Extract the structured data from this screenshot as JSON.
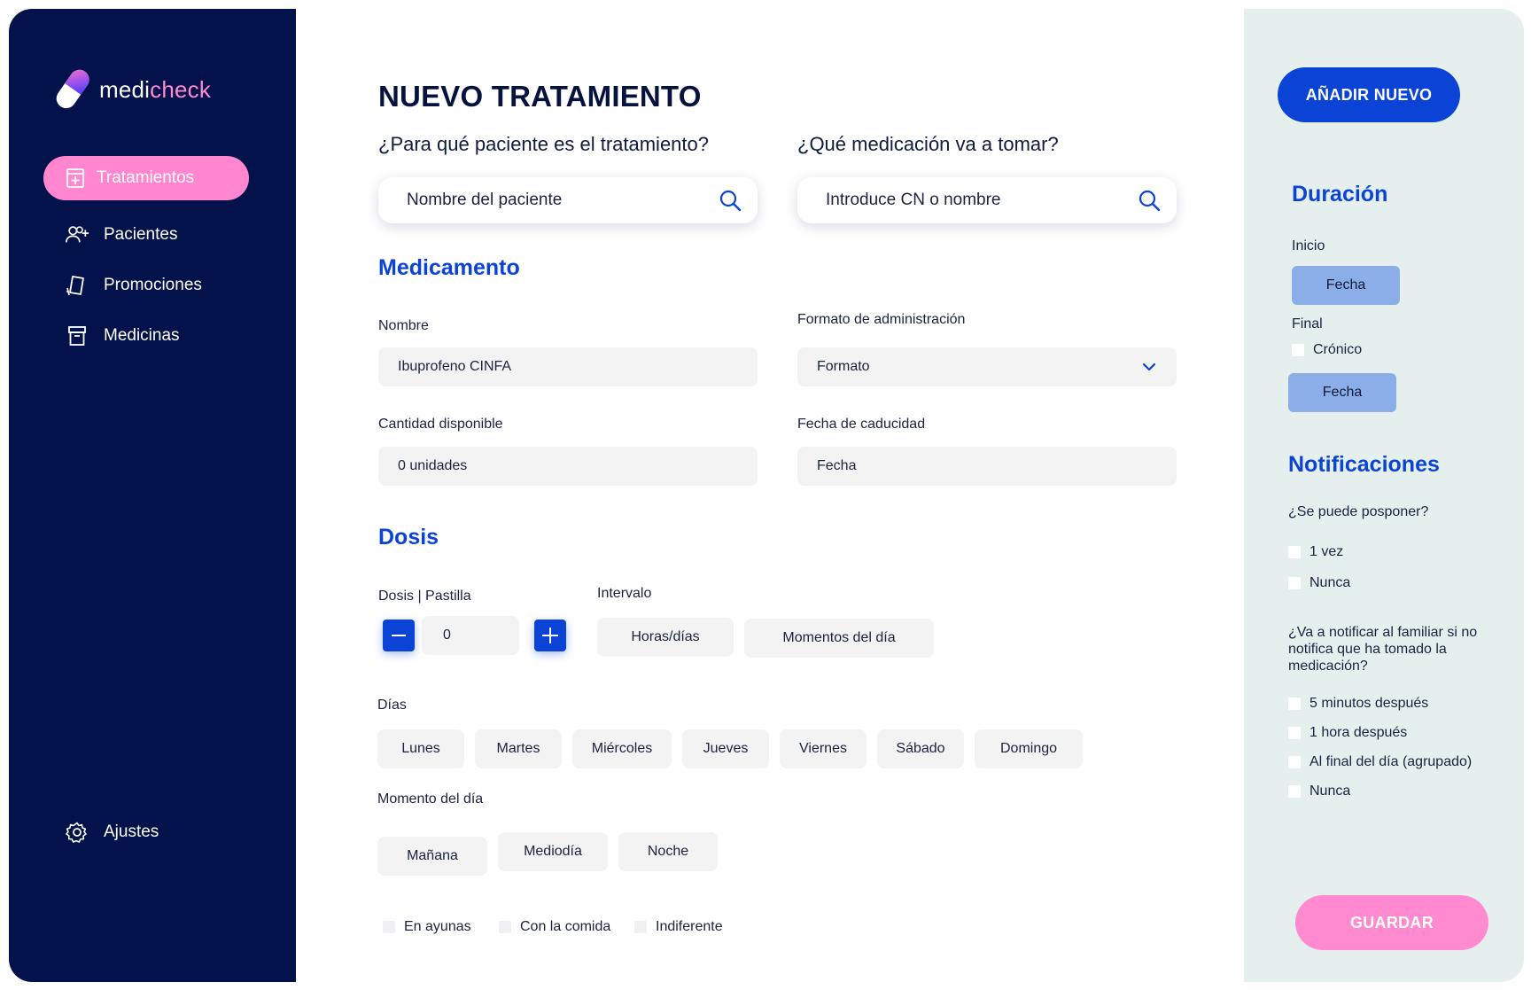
{
  "brand": {
    "name_part1": "medi",
    "name_part2": "check"
  },
  "sidebar": {
    "items": [
      {
        "label": "Tratamientos",
        "icon": "medical-box-icon",
        "active": true
      },
      {
        "label": "Pacientes",
        "icon": "add-user-icon"
      },
      {
        "label": "Promociones",
        "icon": "promotions-icon"
      },
      {
        "label": "Medicinas",
        "icon": "archive-box-icon"
      }
    ],
    "settings_label": "Ajustes"
  },
  "main": {
    "title": "NUEVO TRATAMIENTO",
    "patient_question": "¿Para qué paciente es el tratamiento?",
    "patient_search_placeholder": "Nombre del paciente",
    "medication_question": "¿Qué medicación va a tomar?",
    "medication_search_placeholder": "Introduce CN o nombre",
    "medicamento": {
      "title": "Medicamento",
      "nombre_label": "Nombre",
      "nombre_value": "Ibuprofeno CINFA",
      "formato_label": "Formato de administración",
      "formato_value": "Formato",
      "cantidad_label": "Cantidad disponible",
      "cantidad_value": "0 unidades",
      "caducidad_label": "Fecha de caducidad",
      "caducidad_value": "Fecha"
    },
    "dosis": {
      "title": "Dosis",
      "dosis_label": "Dosis | Pastilla",
      "dosis_value": "0",
      "intervalo_label": "Intervalo",
      "intervalo_options": [
        "Horas/días",
        "Momentos del día"
      ],
      "dias_label": "Días",
      "dias": [
        "Lunes",
        "Martes",
        "Miércoles",
        "Jueves",
        "Viernes",
        "Sábado",
        "Domingo"
      ],
      "momento_label": "Momento del día",
      "momentos": [
        "Mañana",
        "Mediodía",
        "Noche"
      ],
      "comida_options": [
        "En ayunas",
        "Con la comida",
        "Indiferente"
      ]
    }
  },
  "right_panel": {
    "add_button": "AÑADIR NUEVO",
    "duracion": {
      "title": "Duración",
      "inicio_label": "Inicio",
      "inicio_button": "Fecha",
      "final_label": "Final",
      "cronico_label": "Crónico",
      "final_button": "Fecha"
    },
    "notificaciones": {
      "title": "Notificaciones",
      "posponer_question": "¿Se puede posponer?",
      "posponer_options": [
        "1 vez",
        "Nunca"
      ],
      "familiar_question": "¿Va a notificar al familiar si no notifica que ha tomado la medicación?",
      "familiar_options": [
        "5 minutos después",
        "1 hora después",
        "Al final del día (agrupado)",
        "Nunca"
      ]
    },
    "save_button": "GUARDAR"
  },
  "colors": {
    "sidebar_bg": "#03124a",
    "accent_pink": "#ff86cf",
    "accent_blue": "#0a43d6",
    "right_panel_bg": "#e5f0ee",
    "date_button_bg": "#8baee8"
  }
}
